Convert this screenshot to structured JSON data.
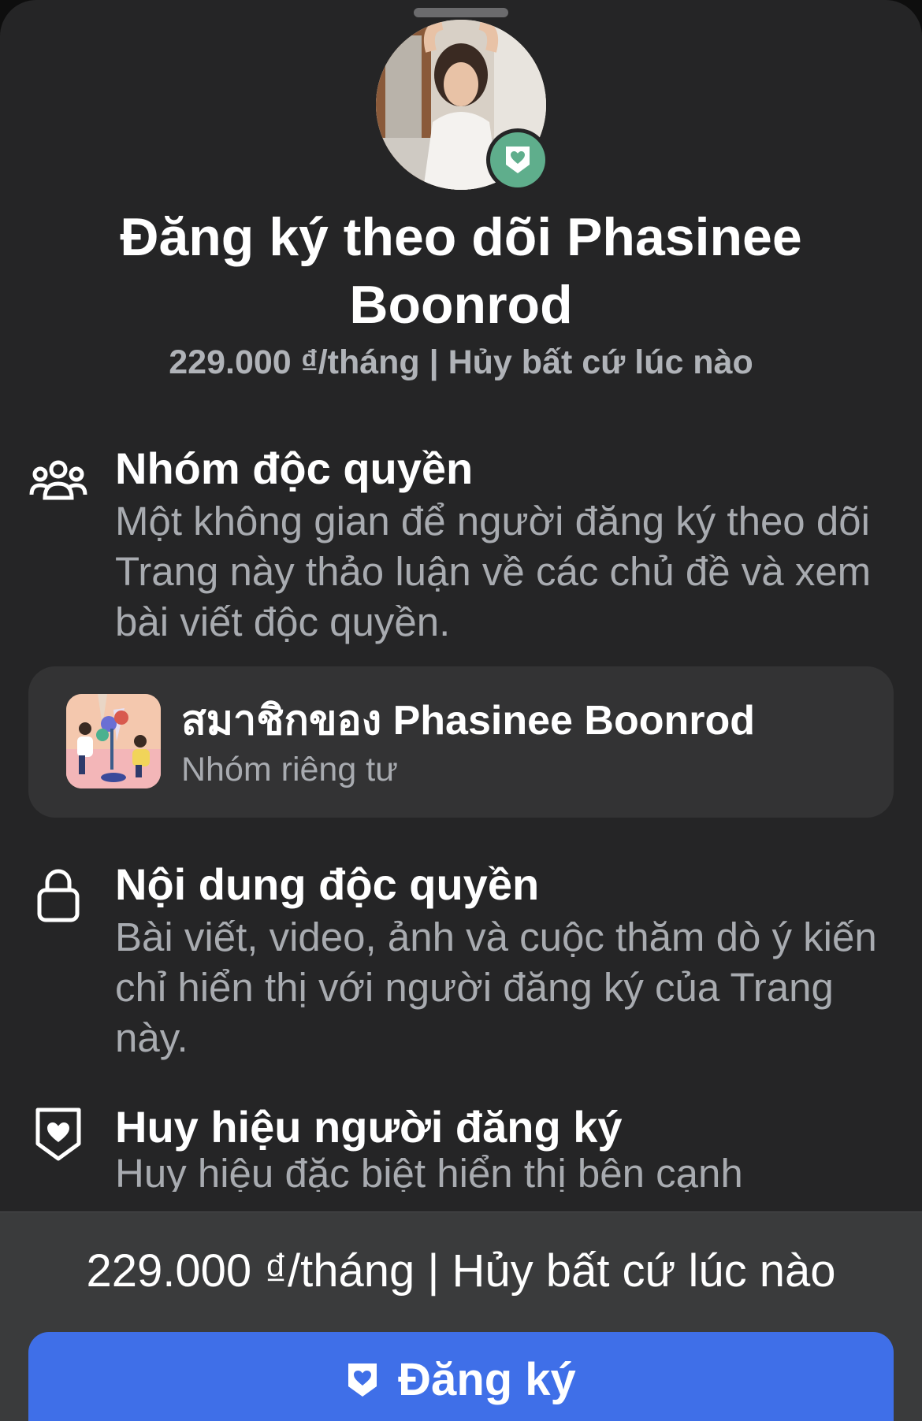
{
  "header": {
    "title": "Đăng ký theo dõi Phasinee Boonrod",
    "price_line": "229.000 ₫/tháng | Hủy bất cứ lúc nào"
  },
  "features": [
    {
      "icon": "group-icon",
      "title": "Nhóm độc quyền",
      "description": "Một không gian để người đăng ký theo dõi Trang này thảo luận về các chủ đề và xem bài viết độc quyền."
    },
    {
      "icon": "lock-icon",
      "title": "Nội dung độc quyền",
      "description": "Bài viết, video, ảnh và cuộc thăm dò ý kiến chỉ hiển thị với người đăng ký của Trang này."
    },
    {
      "icon": "shield-heart-icon",
      "title": "Huy hiệu người đăng ký",
      "description": "Huy hiệu đặc biệt hiển thị bên cạnh"
    }
  ],
  "group_card": {
    "name": "สมาชิกของ Phasinee Boonrod",
    "type": "Nhóm riêng tư"
  },
  "footer": {
    "price_line": "229.000 ₫/tháng | Hủy bất cứ lúc nào",
    "subscribe_label": "Đăng ký"
  },
  "colors": {
    "sheet_bg": "#252526",
    "card_bg": "#333334",
    "footer_bg": "#3a3b3c",
    "primary_button": "#3f6fe8",
    "badge_green": "#5fae8c",
    "secondary_text": "#a8abb0"
  }
}
